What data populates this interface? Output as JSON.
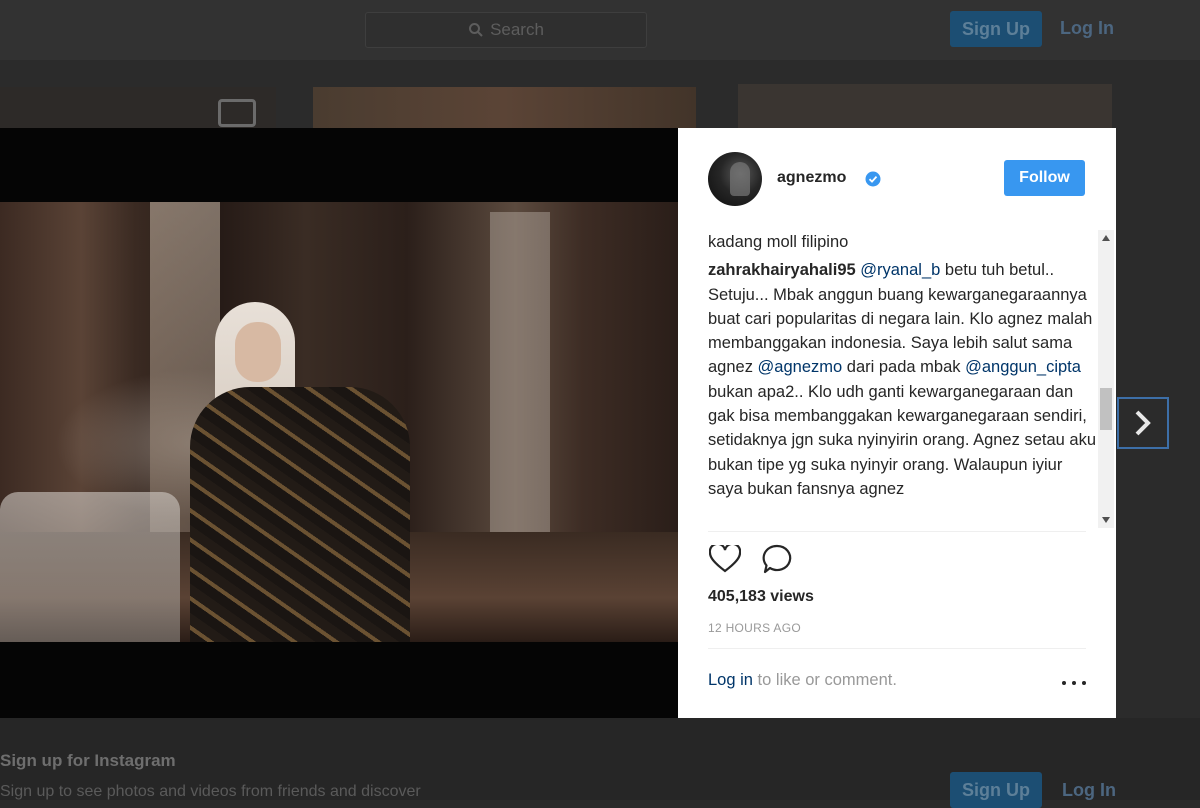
{
  "header": {
    "search_placeholder": "Search",
    "signup_label": "Sign Up",
    "login_label": "Log In"
  },
  "post": {
    "username": "agnezmo",
    "verified": true,
    "follow_label": "Follow",
    "comments": [
      {
        "text": "kadang moll filipino"
      },
      {
        "user": "zahrakhairyahali95",
        "mention1": "@ryanal_b",
        "text1": " betu tuh betul.. Setuju... Mbak anggun buang kewarganegaraannya buat cari popularitas di negara lain. Klo agnez malah membanggakan indonesia. Saya lebih salut sama agnez ",
        "mention2": "@agnezmo",
        "text2": " dari pada mbak ",
        "mention3": "@anggun_cipta",
        "text3": " bukan apa2.. Klo udh ganti kewarganegaraan dan gak bisa membanggakan kewarganegaraan sendiri, setidaknya jgn suka nyinyirin orang. Agnez setau aku bukan tipe yg suka nyinyir orang. Walaupun iyiur saya bukan fansnya agnez"
      }
    ],
    "views": "405,183 views",
    "timestamp": "12 HOURS AGO",
    "login_link": "Log in",
    "login_suffix": " to like or comment."
  },
  "footer": {
    "title": "Sign up for Instagram",
    "subtitle": "Sign up to see photos and videos from friends and discover",
    "signup_label": "Sign Up",
    "login_label": "Log In"
  },
  "colors": {
    "follow_button": "#3897f0",
    "mention": "#003569",
    "verified_badge": "#3897f0"
  },
  "icons": {
    "verified": "verified-badge-icon",
    "like": "heart-icon",
    "comment": "speech-bubble-icon",
    "more": "more-options-icon",
    "next": "chevron-right-icon"
  }
}
